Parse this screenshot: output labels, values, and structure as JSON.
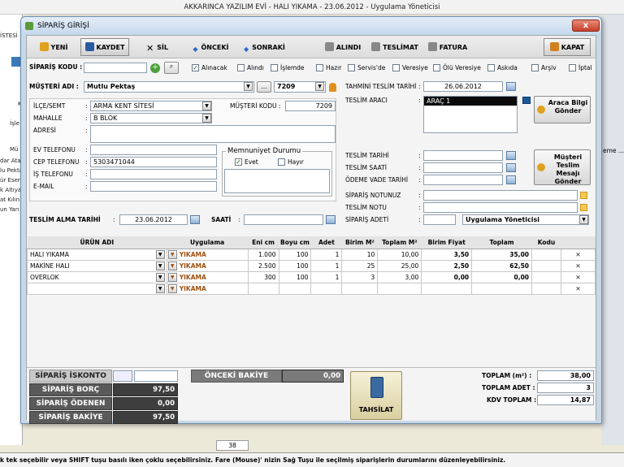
{
  "app_title": "AKKARINCA YAZILIM EVİ - HALI YIKAMA   -   23.06.2012   -   Uygulama Yöneticisi",
  "background": {
    "left_labels": [
      "İSTESİ",
      "dar Ata",
      "lu Pekta",
      "ür Eser",
      "k Altıya",
      "at Kılın",
      "un Yarı",
      "İşle",
      "Mü",
      "K"
    ],
    "right_label": "eme ...",
    "page_count": "38"
  },
  "status_text": "k tek seçebilir veya SHIFT tuşu basılı iken çoklu seçebilirsiniz. Fare (Mouse)' nizin Sağ Tuşu ile seçilmiş siparişlerin durumlarını düzenleyebilirsiniz.",
  "window": {
    "title": "SİPARİŞ GİRİŞİ",
    "close": "x"
  },
  "toolbar": {
    "yeni": "YENİ",
    "kaydet": "KAYDET",
    "sil": "SİL",
    "onceki": "ÖNCEKİ",
    "sonraki": "SONRAKİ",
    "alindi": "ALINDI",
    "teslimat": "TESLİMAT",
    "fatura": "FATURA",
    "kapat": "KAPAT"
  },
  "order_code": {
    "label": "SİPARİŞ KODU :",
    "value": ""
  },
  "status_checks": [
    {
      "label": "Alınacak",
      "checked": true
    },
    {
      "label": "Alındı",
      "checked": false
    },
    {
      "label": "İşlemde",
      "checked": false
    },
    {
      "label": "Hazır",
      "checked": false
    },
    {
      "label": "Servis'de",
      "checked": false
    },
    {
      "label": "Veresiye",
      "checked": false
    },
    {
      "label": "Ölü Veresiye",
      "checked": false
    },
    {
      "label": "Askıda",
      "checked": false
    },
    {
      "label": "Arşiv",
      "checked": false
    },
    {
      "label": "İptal",
      "checked": false
    }
  ],
  "customer": {
    "name_label": "MÜŞTERİ ADI :",
    "name": "Mutlu Pektaş",
    "more": "...",
    "code_box": "7209",
    "district_label": "İLÇE/SEMT",
    "district": "ARMA KENT SİTESİ",
    "neighborhood_label": "MAHALLE",
    "neighborhood": "B BLOK",
    "address_label": "ADRESİ",
    "address": "",
    "customer_code_label": "MÜŞTERİ KODU :",
    "customer_code": "7209",
    "home_phone_label": "EV TELEFONU",
    "home_phone": "",
    "mobile_label": "CEP TELEFONU",
    "mobile": "5303471044",
    "work_phone_label": "İŞ TELEFONU",
    "work_phone": "",
    "email_label": "E-MAIL",
    "email": ""
  },
  "satisfaction": {
    "title": "Memnuniyet Durumu",
    "yes": "Evet",
    "yes_checked": true,
    "no": "Hayır",
    "no_checked": false
  },
  "pickup": {
    "date_label": "TESLİM ALMA TARİHİ",
    "date": "23.06.2012",
    "time_label": "SAATİ",
    "time": ""
  },
  "delivery": {
    "est_label": "TAHMİNİ TESLİM TARİHİ",
    "est_date": "26.06.2012",
    "vehicle_label": "TESLİM ARACI",
    "vehicle": "ARAÇ 1",
    "vehicle_btn": "Araca Bilgi Gönder",
    "date_label": "TESLİM TARİHİ",
    "time_label": "TESLİM SAATİ",
    "payment_label": "ÖDEME VADE TARİHİ",
    "customer_btn": "Müşteri Teslim Mesajı Gönder",
    "order_note_label": "SİPARİŞ NOTUNUZ",
    "delivery_note_label": "TESLİM NOTU",
    "count_label": "SİPARİŞ ADETİ",
    "count": "",
    "user": "Uygulama Yöneticisi"
  },
  "grid": {
    "headers": [
      "ÜRÜN ADI",
      "Uygulama",
      "Eni cm",
      "Boyu cm",
      "Adet",
      "Birim M²",
      "Toplam M²",
      "Birim Fiyat",
      "Toplam",
      "Kodu"
    ],
    "rows": [
      {
        "product": "HALI YIKAMA",
        "app": "YIKAMA",
        "en": "1.000",
        "boy": "100",
        "adet": "1",
        "birim_m2": "10",
        "toplam_m2": "10,00",
        "birim_fiyat": "3,50",
        "toplam": "35,00",
        "kodu": ""
      },
      {
        "product": "MAKİNE HALI",
        "app": "YIKAMA",
        "en": "2.500",
        "boy": "100",
        "adet": "1",
        "birim_m2": "25",
        "toplam_m2": "25,00",
        "birim_fiyat": "2,50",
        "toplam": "62,50",
        "kodu": ""
      },
      {
        "product": "OVERLOK",
        "app": "YIKAMA",
        "en": "300",
        "boy": "100",
        "adet": "1",
        "birim_m2": "3",
        "toplam_m2": "3,00",
        "birim_fiyat": "0,00",
        "toplam": "0,00",
        "kodu": ""
      },
      {
        "product": "",
        "app": "YIKAMA",
        "en": "",
        "boy": "",
        "adet": "",
        "birim_m2": "",
        "toplam_m2": "",
        "birim_fiyat": "",
        "toplam": "",
        "kodu": ""
      }
    ],
    "delete_glyph": "✕"
  },
  "summary": {
    "iskonto_label": "SİPARİŞ İSKONTO",
    "iskonto": "",
    "borc_label": "SİPARİŞ BORÇ",
    "borc": "97,50",
    "odenen_label": "SİPARİŞ ÖDENEN",
    "odenen": "0,00",
    "bakiye_label": "SİPARİŞ BAKİYE",
    "bakiye": "97,50",
    "onceki_label": "ÖNCEKİ BAKİYE",
    "onceki": "0,00",
    "tahsilat": "TAHSİLAT",
    "toplam_m2_label": "TOPLAM (m²) :",
    "toplam_m2": "38,00",
    "toplam_adet_label": "TOPLAM ADET :",
    "toplam_adet": "3",
    "kdv_label": "KDV TOPLAM :",
    "kdv": "14,87"
  },
  "colors": {
    "title_bar": "#c5d8ec",
    "dark_panel": "#5a5a5a",
    "accent_orange": "#a05010"
  }
}
